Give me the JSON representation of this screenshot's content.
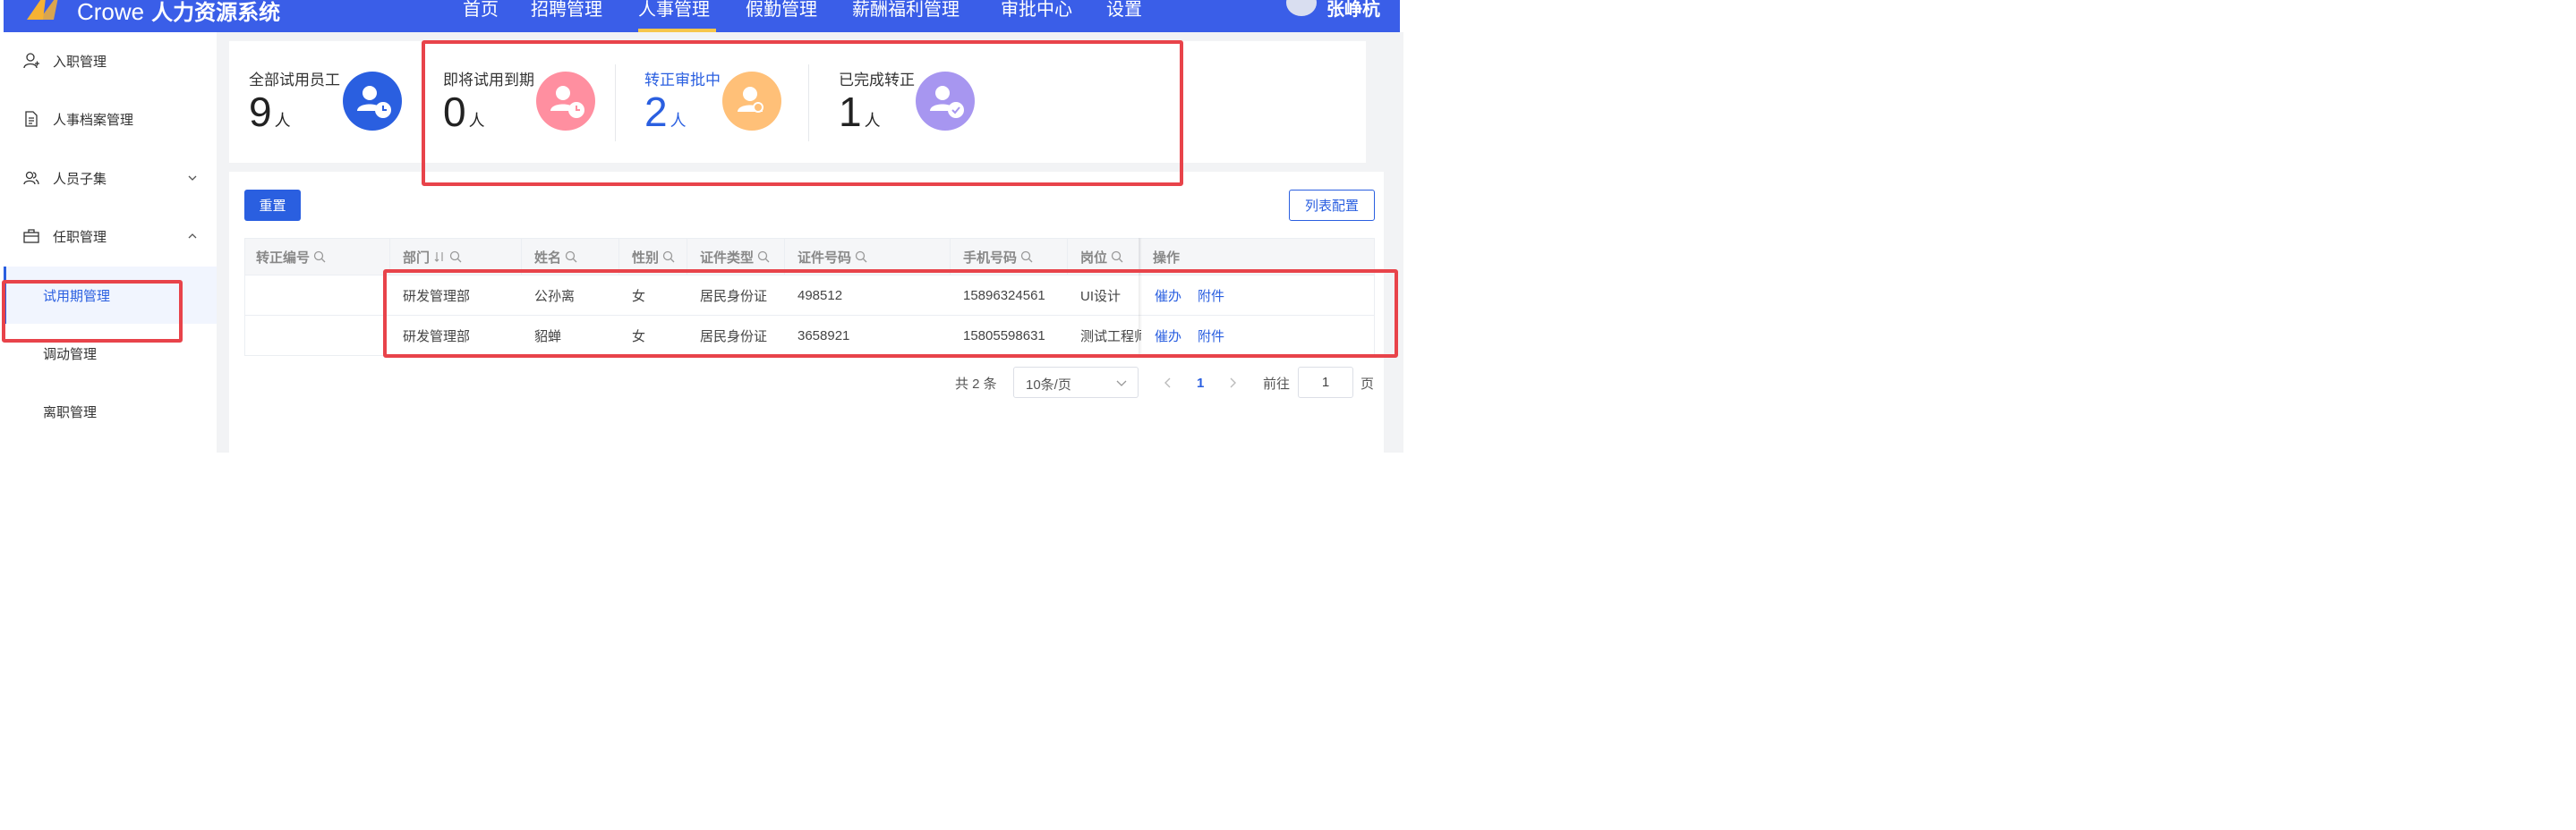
{
  "header": {
    "brand_en": "Crowe",
    "brand_cn": "人力资源系统",
    "nav": [
      "首页",
      "招聘管理",
      "人事管理",
      "假勤管理",
      "薪酬福利管理",
      "审批中心",
      "设置"
    ],
    "user_name": "张峥杭"
  },
  "sidebar": {
    "onboarding": "入职管理",
    "archives": "人事档案管理",
    "subsets": "人员子集",
    "employment": "任职管理",
    "probation": "试用期管理",
    "transfer": "调动管理",
    "resignation": "离职管理"
  },
  "stats": [
    {
      "label": "全部试用员工",
      "value": "9",
      "unit": "人",
      "color": "#2a5fe0"
    },
    {
      "label": "即将试用到期",
      "value": "0",
      "unit": "人",
      "color": "#ff8fa0"
    },
    {
      "label": "转正审批中",
      "value": "2",
      "unit": "人",
      "color": "#ffc078"
    },
    {
      "label": "已完成转正",
      "value": "1",
      "unit": "人",
      "color": "#a796f0"
    }
  ],
  "toolbar": {
    "reset_label": "重置",
    "config_label": "列表配置"
  },
  "table": {
    "columns": [
      "转正编号",
      "部门",
      "姓名",
      "性别",
      "证件类型",
      "证件号码",
      "手机号码",
      "岗位",
      "操作"
    ],
    "rows": [
      {
        "id": "",
        "dept": "研发管理部",
        "name": "公孙离",
        "gender": "女",
        "idtype": "居民身份证",
        "idno": "498512",
        "phone": "15896324561",
        "post": "UI设计",
        "act1": "催办",
        "act2": "附件"
      },
      {
        "id": "",
        "dept": "研发管理部",
        "name": "貂蝉",
        "gender": "女",
        "idtype": "居民身份证",
        "idno": "3658921",
        "phone": "15805598631",
        "post": "测试工程师",
        "act1": "催办",
        "act2": "附件"
      }
    ]
  },
  "pagination": {
    "total_text": "共 2 条",
    "page_size": "10条/页",
    "current_page": "1",
    "goto_label": "前往",
    "goto_value": "1",
    "page_suffix": "页"
  },
  "colors": {
    "primary": "#2a5fe0",
    "header": "#3a5ee8",
    "highlight": "#e8434a"
  }
}
